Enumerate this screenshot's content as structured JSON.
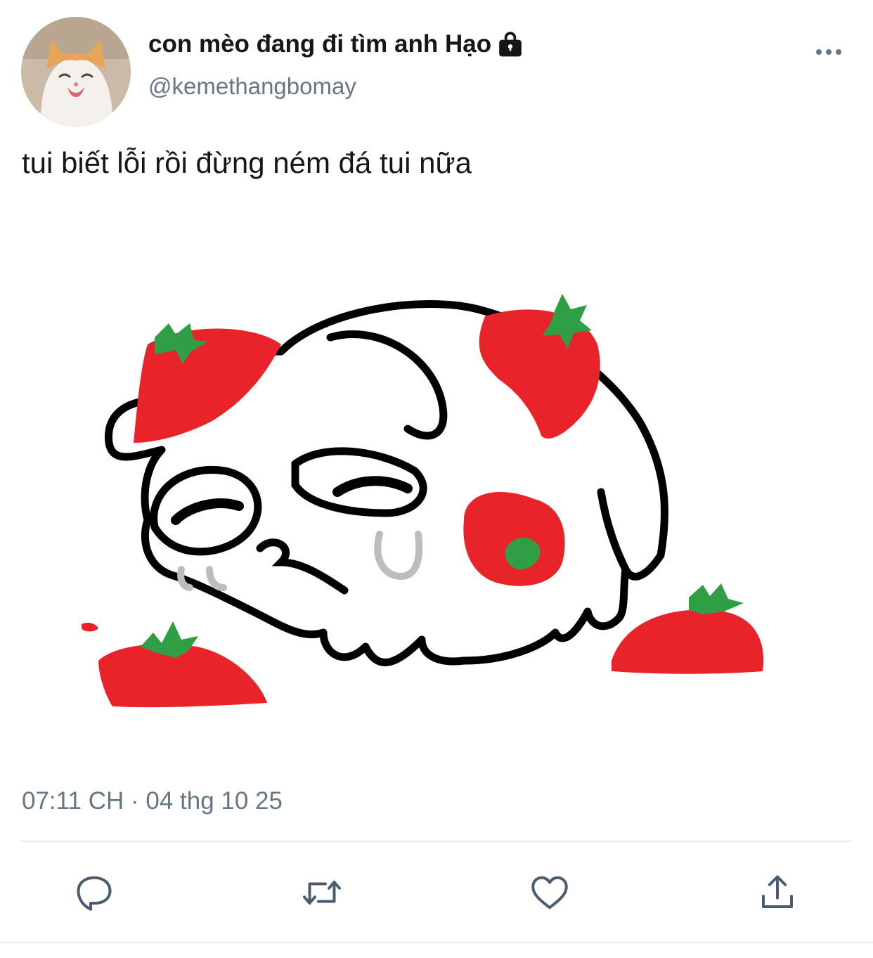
{
  "tweet": {
    "author": {
      "display_name": "con mèo đang đi tìm anh Hạo",
      "handle": "@kemethangbomay",
      "protected_icon": "lock-icon"
    },
    "text": "tui biết lỗi rồi đừng ném đá tui nữa",
    "timestamp": "07:11 CH · 04 thg 10 25",
    "media": {
      "kind": "image",
      "subject": "drawing-of-white-creature-with-strawberries"
    }
  },
  "header": {
    "more_icon": "more-horizontal-icon"
  },
  "actions": [
    {
      "name": "reply",
      "icon": "reply-icon"
    },
    {
      "name": "retweet",
      "icon": "retweet-icon"
    },
    {
      "name": "like",
      "icon": "heart-icon"
    },
    {
      "name": "share",
      "icon": "share-icon"
    }
  ],
  "colors": {
    "primary_text": "#14171a",
    "secondary_text": "#657786",
    "icon": "#4a5d70",
    "divider": "#e6ecf0",
    "strawberry_red": "#e8242a",
    "leaf_green": "#2f9e44"
  }
}
